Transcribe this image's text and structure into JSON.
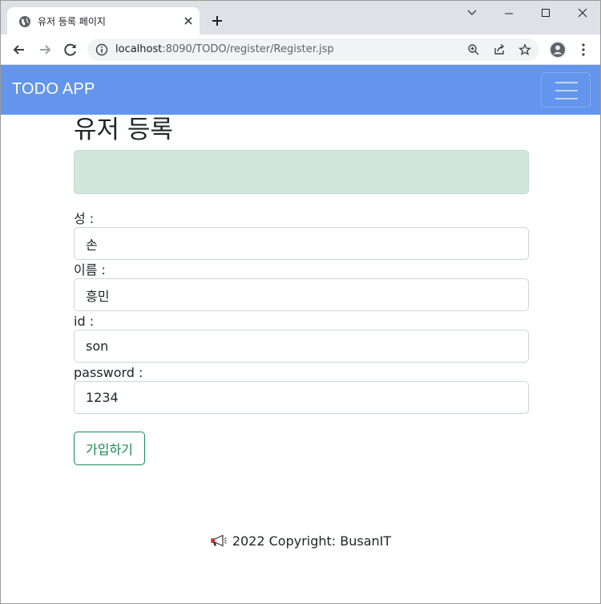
{
  "browser": {
    "tab_title": "유저 등록 페이지",
    "url_host": "localhost",
    "url_rest": ":8090/TODO/register/Register.jsp"
  },
  "navbar": {
    "brand": "TODO APP"
  },
  "page": {
    "heading": "유저 등록",
    "alert_message": ""
  },
  "form": {
    "fields": [
      {
        "label": "성 :",
        "value": "손"
      },
      {
        "label": "이름 :",
        "value": "흥민"
      },
      {
        "label": "id :",
        "value": "son"
      },
      {
        "label": "password :",
        "value": "1234"
      }
    ],
    "submit_label": "가입하기"
  },
  "footer": {
    "text": "2022 Copyright: BusanIT"
  },
  "colors": {
    "navbar": "#6495ed",
    "alert_bg": "#d1e7dd",
    "button_border": "#198754"
  }
}
